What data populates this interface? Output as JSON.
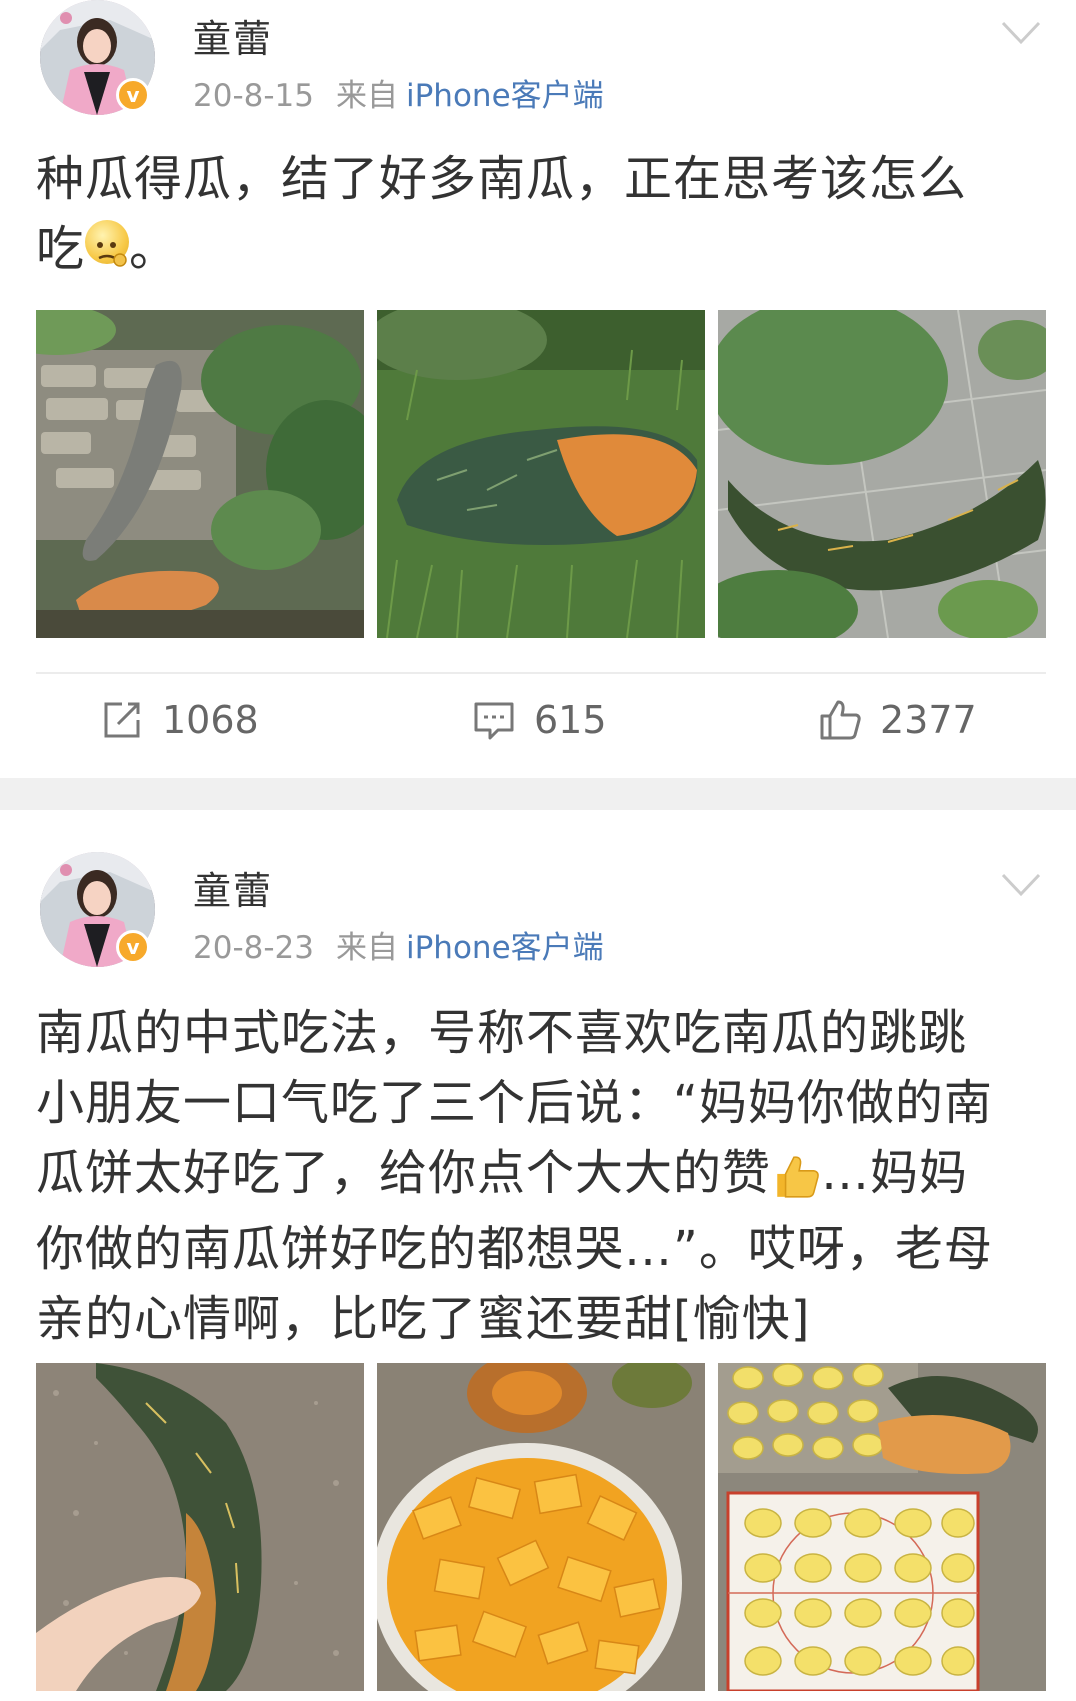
{
  "posts": [
    {
      "username": "童蕾",
      "date": "20-8-15",
      "source_prefix": "来自",
      "client": "iPhone客户端",
      "text_line1": "种瓜得瓜，结了好多南瓜，正在思考该怎么",
      "text_line2_a": "吃",
      "text_line2_b": "。",
      "photos": [
        "pumpkins-by-stone-wall",
        "pumpkin-in-grass",
        "pumpkin-under-leaves"
      ],
      "repost_count": "1068",
      "comment_count": "615",
      "like_count": "2377"
    },
    {
      "username": "童蕾",
      "date": "20-8-23",
      "source_prefix": "来自",
      "client": "iPhone客户端",
      "text_line1": "南瓜的中式吃法，号称不喜欢吃南瓜的跳跳",
      "text_line2": "小朋友一口气吃了三个后说：“妈妈你做的南",
      "text_line3_a": "瓜饼太好吃了，给你点个大大的赞",
      "text_line3_b": "…妈妈",
      "text_line4": "你做的南瓜饼好吃的都想哭…”。哎呀，老母",
      "text_line5": "亲的心情啊，比吃了蜜还要甜[愉快]",
      "photos": [
        "pumpkin-held-in-hand",
        "diced-pumpkin-bowl",
        "pumpkin-cakes-on-mat"
      ]
    }
  ],
  "icons": {
    "verified": "v-badge",
    "menu": "chevron-down-icon",
    "repost": "repost-icon",
    "comment": "comment-icon",
    "like": "thumbs-up-icon"
  },
  "colors": {
    "client_link": "#4a7ab8",
    "verified_badge": "#f7a92b",
    "meta_gray": "#999999",
    "separator": "#f0f0f0"
  }
}
